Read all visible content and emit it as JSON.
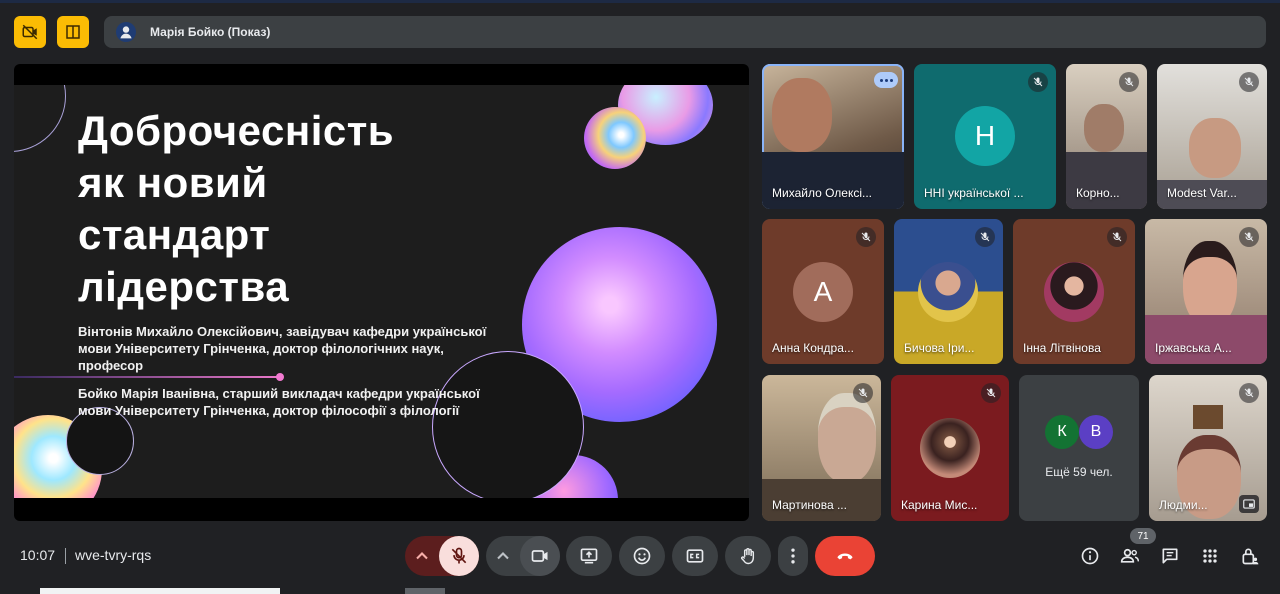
{
  "topbar": {
    "presenter_name": "Марія Бойко (Показ)",
    "buttons": [
      "camera-off-icon",
      "layout-icon"
    ]
  },
  "slide": {
    "title_lines": [
      "Доброчесність",
      "як новий",
      "стандарт",
      "лідерства"
    ],
    "author1": "Вінтонів Михайло Олексійович, завідувач кафедри української мови Університету Грінченка, доктор філологічних наук, професор",
    "author2": "Бойко Марія Іванівна, старший викладач кафедри української мови Університету Грінченка, доктор філософії з філології"
  },
  "participants": [
    {
      "name": "Михайло Олексі...",
      "type": "video",
      "active": true
    },
    {
      "name": "ННІ української ...",
      "type": "letter",
      "letter": "Н",
      "muted": true
    },
    {
      "name": "Корно...",
      "type": "video",
      "muted": true
    },
    {
      "name": "Modest Var...",
      "type": "video",
      "muted": true
    },
    {
      "name": "Анна Кондра...",
      "type": "letter",
      "letter": "А",
      "muted": true
    },
    {
      "name": "Бичова Іри...",
      "type": "photo",
      "muted": true
    },
    {
      "name": "Інна Літвінова",
      "type": "photo",
      "muted": true
    },
    {
      "name": "Іржавська А...",
      "type": "video",
      "muted": true
    },
    {
      "name": "Мартинова ...",
      "type": "video",
      "muted": true
    },
    {
      "name": "Карина Мис...",
      "type": "photo",
      "muted": true
    },
    {
      "name": "Ещё 59 чел.",
      "type": "others",
      "letters": [
        "К",
        "В"
      ]
    },
    {
      "name": "Людми...",
      "type": "video",
      "muted": true
    }
  ],
  "bottombar": {
    "time": "10:07",
    "meeting_code": "wve-tvry-rqs",
    "people_count": "71"
  },
  "colors": {
    "background": "#202124",
    "accent_yellow": "#fbbc04",
    "end_call": "#ea4335",
    "mic_off_bg": "#f9dedc",
    "teal_avatar": "#12a5a5",
    "tile_teal": "#0f6b6e",
    "tile_brown": "#6e3b2a"
  }
}
